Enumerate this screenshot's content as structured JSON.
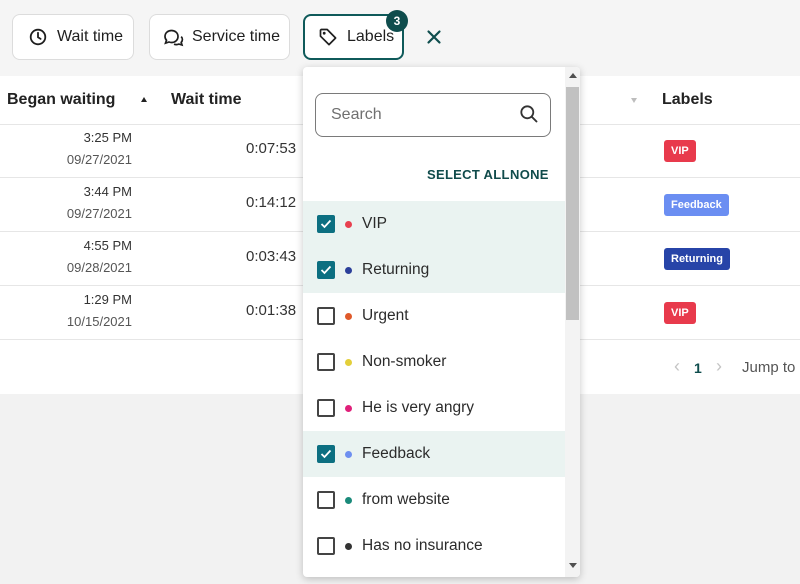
{
  "filters": {
    "wait_time": "Wait time",
    "service_time": "Service time",
    "labels": "Labels",
    "labels_count": "3",
    "clear_icon": "close-icon"
  },
  "table": {
    "columns": {
      "began_waiting": "Began waiting",
      "wait_time": "Wait time",
      "labels": "Labels"
    },
    "rows": [
      {
        "time": "3:25 PM",
        "date": "09/27/2021",
        "wait": "0:07:53",
        "label": "VIP"
      },
      {
        "time": "3:44 PM",
        "date": "09/27/2021",
        "wait": "0:14:12",
        "label": "Feedback"
      },
      {
        "time": "4:55 PM",
        "date": "09/28/2021",
        "wait": "0:03:43",
        "label": "Returning"
      },
      {
        "time": "1:29 PM",
        "date": "10/15/2021",
        "wait": "0:01:38",
        "label": "VIP"
      }
    ],
    "pagination": {
      "prev": "‹",
      "page": "1",
      "next": "›",
      "jump": "Jump to"
    }
  },
  "dropdown": {
    "search_placeholder": "Search",
    "select_all": "SELECT ALL",
    "none": "NONE",
    "options": [
      {
        "label": "VIP",
        "checked": true,
        "color": "#e8404f"
      },
      {
        "label": "Returning",
        "checked": true,
        "color": "#2b3f9a"
      },
      {
        "label": "Urgent",
        "checked": false,
        "color": "#e05a2a"
      },
      {
        "label": "Non-smoker",
        "checked": false,
        "color": "#e3cf3a"
      },
      {
        "label": "He is very angry",
        "checked": false,
        "color": "#e0207a"
      },
      {
        "label": "Feedback",
        "checked": true,
        "color": "#6e8ff0"
      },
      {
        "label": "from website",
        "checked": false,
        "color": "#1a8a7a"
      },
      {
        "label": "Has no insurance",
        "checked": false,
        "color": "#333333"
      }
    ]
  },
  "colors": {
    "vip": "#e83a4c",
    "feedback": "#6b8ef2",
    "returning": "#2744a8",
    "accent": "#0f4d4d"
  }
}
